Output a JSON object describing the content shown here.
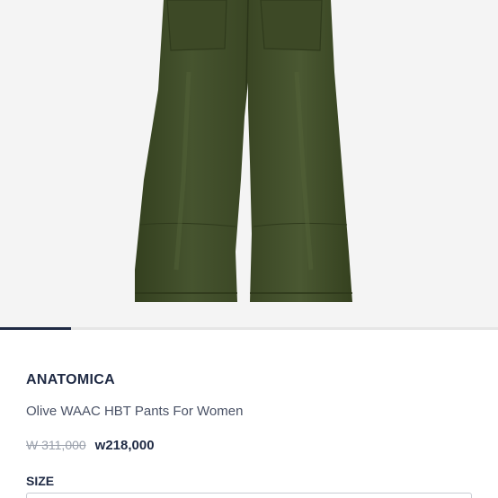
{
  "product": {
    "brand": "ANATOMICA",
    "title": "Olive WAAC HBT Pants For Women",
    "original_price": "W 311,000",
    "sale_price": "w218,000"
  },
  "carousel": {
    "current_slide": 1,
    "total_slides": 7
  },
  "options": {
    "size_label": "SIZE",
    "size_value": ""
  },
  "colors": {
    "brand_text": "#1f2a44",
    "strikethrough_price": "#9aa0ab",
    "garment": "#3e4a2c"
  }
}
